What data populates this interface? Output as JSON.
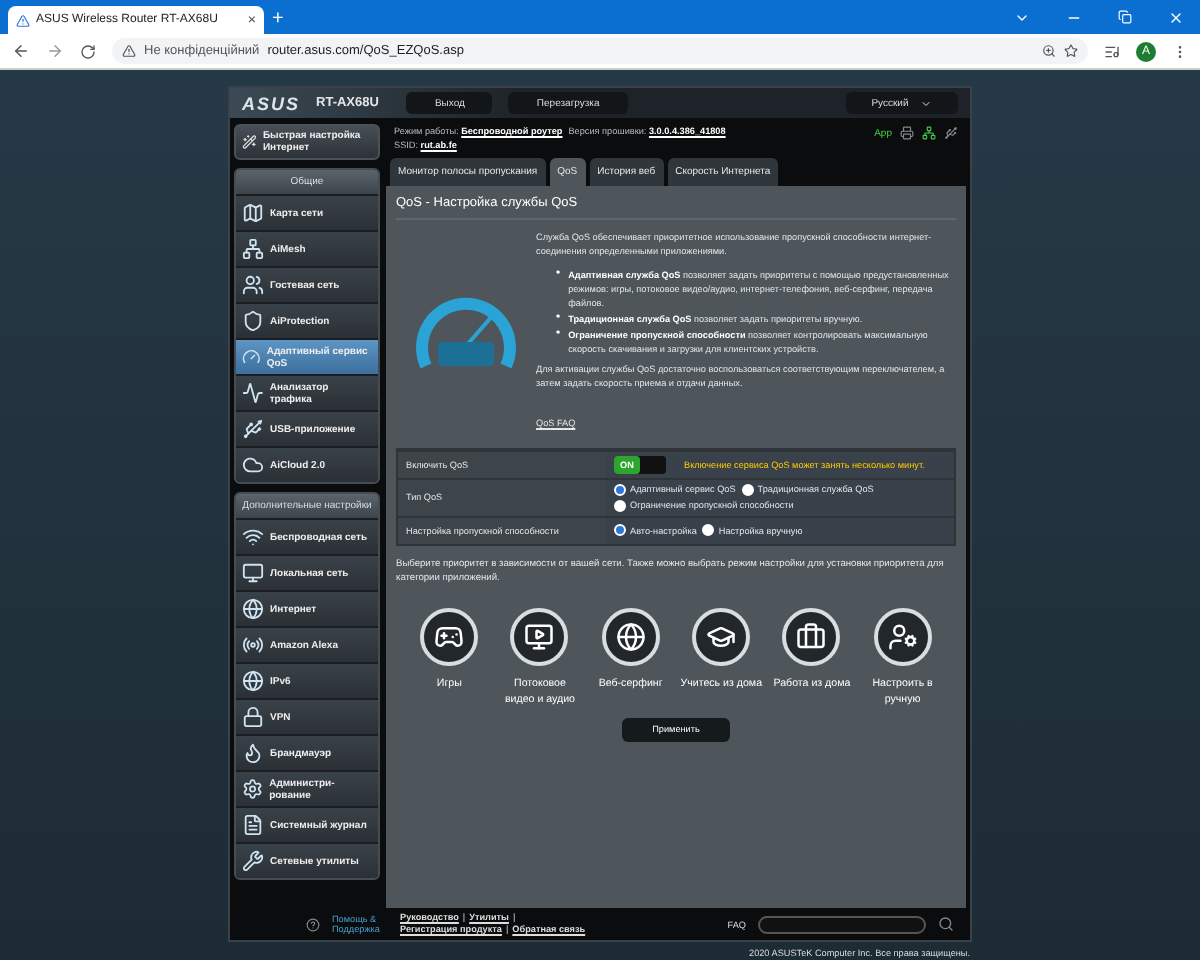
{
  "browser": {
    "tab": {
      "title": "ASUS Wireless Router RT-AX68U",
      "close": "×"
    },
    "new_tab": "+",
    "security": "Не конфіденційний",
    "url": "router.asus.com/QoS_EZQoS.asp",
    "profile": "A"
  },
  "header": {
    "logo": "ASUS",
    "model": "RT-AX68U",
    "buttons": [
      "Выход",
      "Перезагрузка"
    ],
    "language": "Русский"
  },
  "info": {
    "mode_label": "Режим работы:",
    "mode": "Беспроводной роутер",
    "firmware_label": "Версия прошивки:",
    "firmware": "3.0.0.4.386_41808",
    "ssid_label": "SSID:",
    "ssid": "rut.ab.fe",
    "app": "App"
  },
  "sidebar": {
    "quick": {
      "label": "Быстрая настройка Интернет"
    },
    "sections": [
      {
        "title": "Общие",
        "items": [
          {
            "label": "Карта сети",
            "selected": false
          },
          {
            "label": "AiMesh",
            "selected": false
          },
          {
            "label": "Гостевая сеть",
            "selected": false
          },
          {
            "label": "AiProtection",
            "selected": false
          },
          {
            "label": "Адаптивный сервис QoS",
            "selected": true
          },
          {
            "label": "Анализатор трафика",
            "selected": false
          },
          {
            "label": "USB-приложение",
            "selected": false
          },
          {
            "label": "AiCloud 2.0",
            "selected": false
          }
        ]
      },
      {
        "title": "Дополнительные настройки",
        "items": [
          {
            "label": "Беспроводная сеть",
            "selected": false
          },
          {
            "label": "Локальная сеть",
            "selected": false
          },
          {
            "label": "Интернет",
            "selected": false
          },
          {
            "label": "Amazon Alexa",
            "selected": false
          },
          {
            "label": "IPv6",
            "selected": false
          },
          {
            "label": "VPN",
            "selected": false
          },
          {
            "label": "Брандмауэр",
            "selected": false
          },
          {
            "label": "Администри-рование",
            "selected": false
          },
          {
            "label": "Системный журнал",
            "selected": false
          },
          {
            "label": "Сетевые утилиты",
            "selected": false
          }
        ]
      }
    ]
  },
  "tabs": [
    {
      "label": "Монитор полосы пропускания",
      "selected": false
    },
    {
      "label": "QoS",
      "selected": true
    },
    {
      "label": "История веб",
      "selected": false
    },
    {
      "label": "Скорость Интернета",
      "selected": false
    }
  ],
  "content": {
    "title": "QoS - Настройка службы QoS",
    "intro": "Служба QoS обеспечивает приоритетное использование пропускной способности интернет-соединения определенными приложениями.",
    "bullets": [
      {
        "marker": "•",
        "text": "**Адаптивная служба QoS** позволяет задать приоритеты с помощью предустановленных режимов: игры, потоковое видео/аудио, интернет-телефония, веб-серфинг, передача файлов."
      },
      {
        "marker": "•",
        "text": "**Традиционная служба QoS** позволяет задать приоритеты вручную."
      },
      {
        "marker": "•",
        "text": "**Ограничение пропускной способности** позволяет контролировать максимальную скорость скачивания и загрузки для клиентских устройств."
      }
    ],
    "activation": "Для активации службы QoS достаточно воспользоваться соответствующим переключателем, а затем задать скорость приема и отдачи данных.",
    "faq": "QoS FAQ",
    "settings": [
      {
        "kind": "toggle",
        "label": "Включить QoS",
        "toggle": {
          "text": "ON",
          "on": true
        },
        "note": "Включение сервиса QoS может занять несколько минут."
      },
      {
        "kind": "radio",
        "label": "Тип QoS",
        "options": [
          {
            "label": "Адаптивный сервис QoS",
            "selected": true
          },
          {
            "label": "Традиционная служба QoS",
            "selected": false
          },
          {
            "label": "Ограничение пропускной способности",
            "selected": false
          }
        ]
      },
      {
        "kind": "radio",
        "label": "Настройка пропускной способности",
        "options": [
          {
            "label": "Авто-настройка",
            "selected": true
          },
          {
            "label": "Настройка вручную",
            "selected": false
          }
        ]
      }
    ],
    "prompt": "Выберите приоритет в зависимости от вашей сети. Также можно выбрать режим настройки для установки приоритета для категории приложений.",
    "modes": [
      "Игры",
      "Потоковое видео и аудио",
      "Веб-серфинг",
      "Учитесь из дома",
      "Работа из дома",
      "Настроить в ручную"
    ],
    "apply": "Применить"
  },
  "footer": {
    "help": "Помощь & Поддержка",
    "links": [
      {
        "kind": "link",
        "text": "Руководство"
      },
      {
        "kind": "sep",
        "text": "|"
      },
      {
        "kind": "link",
        "text": "Утилиты"
      },
      {
        "kind": "sep",
        "text": "|"
      },
      {
        "kind": "link",
        "text": "Регистрация продукта"
      },
      {
        "kind": "sep",
        "text": "|"
      },
      {
        "kind": "link",
        "text": "Обратная связь"
      }
    ],
    "faq_label": "FAQ"
  },
  "copyright": "2020 ASUSTeK Computer Inc. Все права защищены."
}
